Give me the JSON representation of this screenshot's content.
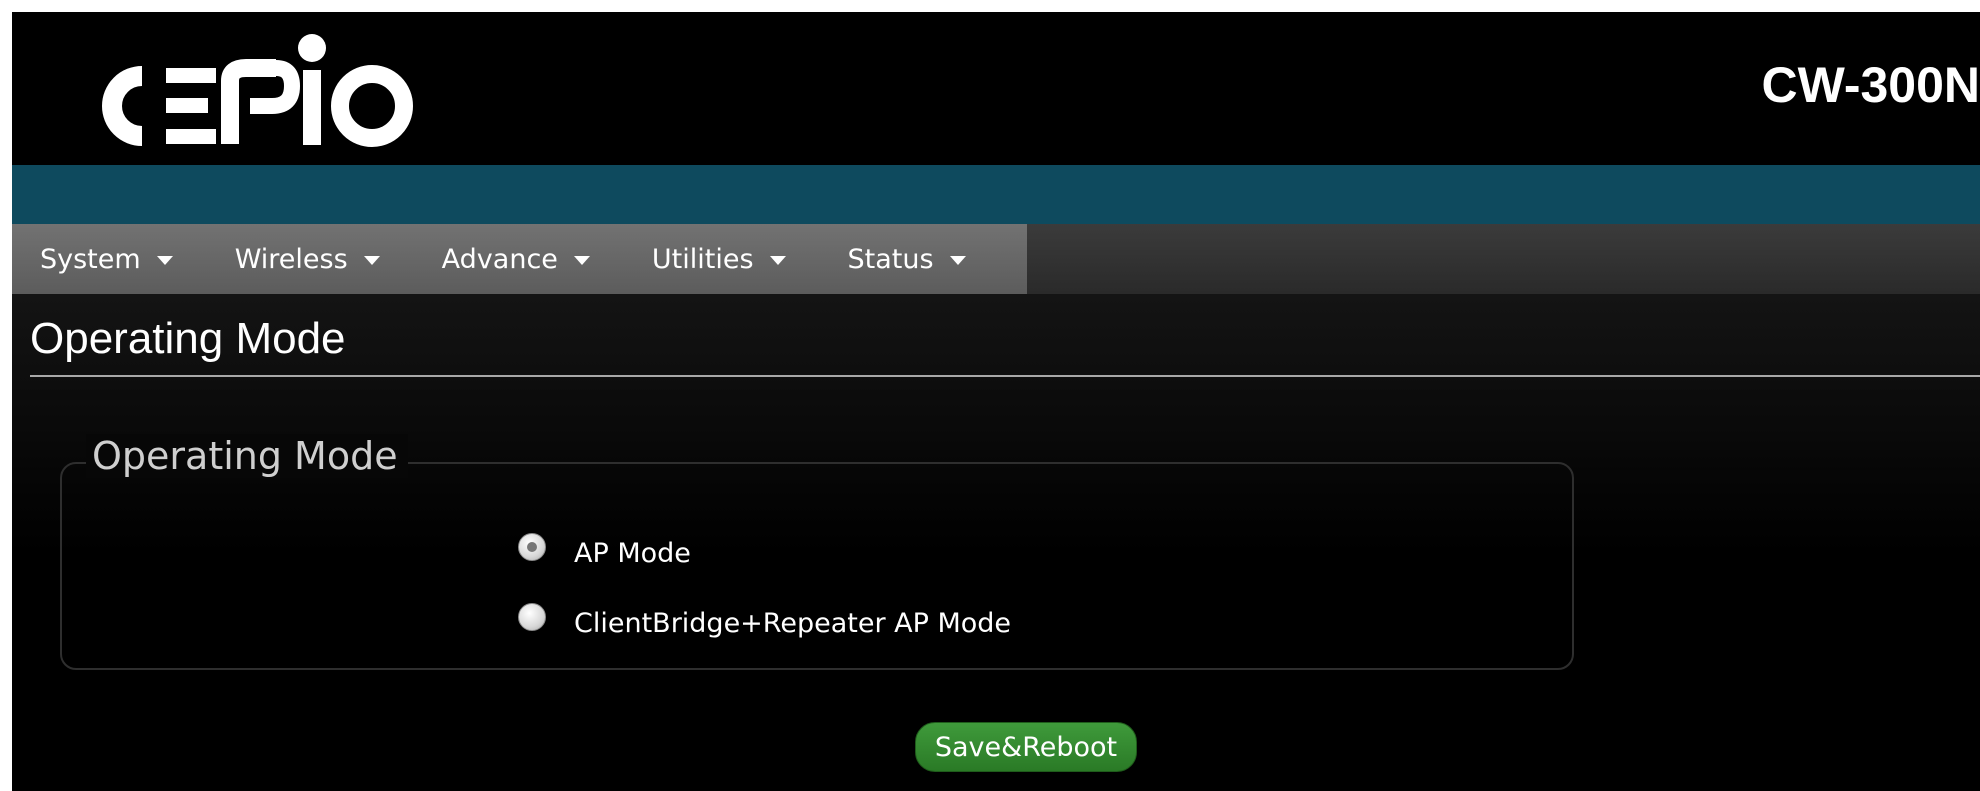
{
  "header": {
    "brand": "CERIO",
    "model": "CW-300N"
  },
  "menu": {
    "items": [
      {
        "label": "System"
      },
      {
        "label": "Wireless"
      },
      {
        "label": "Advance"
      },
      {
        "label": "Utilities"
      },
      {
        "label": "Status"
      }
    ]
  },
  "page": {
    "title": "Operating Mode"
  },
  "operating_mode": {
    "legend": "Operating Mode",
    "options": [
      {
        "label": "AP Mode",
        "checked": true
      },
      {
        "label": "ClientBridge+Repeater AP Mode",
        "checked": false
      }
    ]
  },
  "actions": {
    "save_label": "Save&Reboot"
  },
  "colors": {
    "header_bg": "#000000",
    "band": "#0e4a5e",
    "menu_active": "#6a6a6a",
    "button_green": "#2e8a2a"
  }
}
